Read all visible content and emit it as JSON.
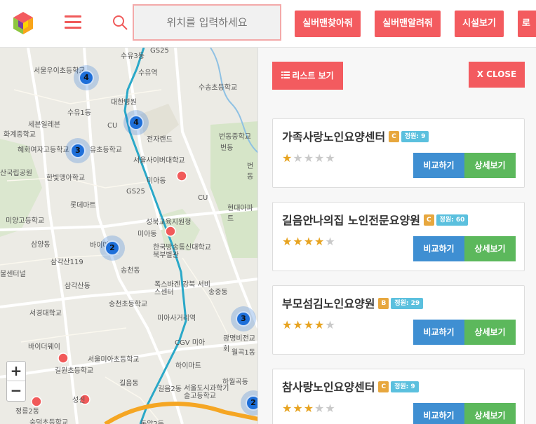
{
  "header": {
    "search_placeholder": "위치를 입력하세요",
    "buttons": [
      "실버맨찾아줘",
      "실버맨알려줘",
      "시설보기",
      "로"
    ]
  },
  "map": {
    "labels": [
      "서울우이초등학교",
      "수유3동",
      "GS25",
      "수유역",
      "수송초등학교",
      "대한병원",
      "수유1동",
      "CU",
      "세븐일레븐",
      "화계중학교",
      "혜화여자고등학교",
      "유초등학교",
      "전자랜드",
      "번동중학교",
      "번동",
      "서울사이버대학교",
      "산국립공원",
      "한빛맹아학교",
      "미아동",
      "번동",
      "롯데마트",
      "GS25",
      "CU",
      "현대아파트",
      "미양고등학교",
      "성북교육지원청",
      "미아동",
      "삼양동",
      "바이마트",
      "한국방송통신대학교 북부별관",
      "삼각산119",
      "송천동",
      "불센터널",
      "삼각산동",
      "폭스바겐 강북 서비스센터",
      "송중동",
      "송천초등학교",
      "서경대학교",
      "미아사거리역",
      "CGV 미아",
      "광명비전교회",
      "바이더웨이",
      "서울미아초등학교",
      "하이마트",
      "길원초등학교",
      "월곡1동",
      "길음동",
      "길음2동",
      "서울도시과학기술고등학교",
      "하월곡동",
      "정릉2동",
      "성신",
      "숭덕초등학교",
      "돈암2동"
    ],
    "clusters": [
      "4",
      "4",
      "3",
      "2",
      "3",
      "2"
    ],
    "zoom_in": "+",
    "zoom_out": "−"
  },
  "panel": {
    "list_label": "리스트 보기",
    "close_label": "X CLOSE",
    "compare_label": "비교하기",
    "detail_label": "상세보기",
    "items": [
      {
        "name": "가족사랑노인요양센터",
        "grade": "C",
        "capacity": "정원: 9",
        "rating": 1
      },
      {
        "name": "길음안나의집 노인전문요양원",
        "grade": "C",
        "capacity": "정원: 60",
        "rating": 4
      },
      {
        "name": "부모섬김노인요양원",
        "grade": "B",
        "capacity": "정원: 29",
        "rating": 4
      },
      {
        "name": "참사랑노인요양센터",
        "grade": "C",
        "capacity": "정원: 9",
        "rating": 3
      }
    ]
  },
  "colors": {
    "accent": "#f35b5f",
    "blue": "#3f8fd2",
    "green": "#5cb85c",
    "cluster": "#1e6fd9"
  }
}
